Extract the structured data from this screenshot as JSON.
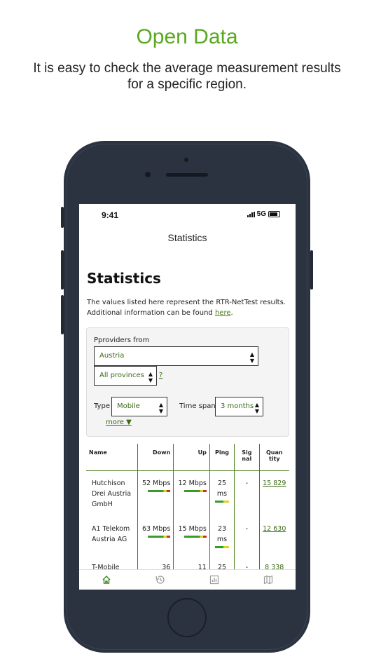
{
  "hero": {
    "title": "Open Data",
    "subtitle": "It is easy to check the average measurement results for a specific region."
  },
  "status_bar": {
    "time": "9:41",
    "network": "5G"
  },
  "nav": {
    "title": "Statistics"
  },
  "page": {
    "heading": "Statistics",
    "intro_text": "The values listed here represent the RTR-NetTest results. Additional information can be found",
    "intro_link": "here",
    "intro_end": "."
  },
  "filter": {
    "providers_label": "Pproviders from",
    "country_value": "Austria",
    "province_value": "All provinces",
    "help_link": "?",
    "type_label": "Type",
    "type_value": "Mobile",
    "timespan_label": "Time span",
    "timespan_value": "3 months",
    "more_link": "more ▼"
  },
  "table": {
    "headers": {
      "name": "Name",
      "down": "Down",
      "up": "Up",
      "ping": "Ping",
      "signal": "Sig nal",
      "quantity": "Quan tity"
    },
    "rows": [
      {
        "name": "Hutchison Drei Austria GmbH",
        "down": "52 Mbps",
        "up": "12 Mbps",
        "ping": "25 ms",
        "signal": "-",
        "quantity": "15 829"
      },
      {
        "name": "A1 Telekom Austria AG",
        "down": "63 Mbps",
        "up": "15 Mbps",
        "ping": "23 ms",
        "signal": "-",
        "quantity": "12 630"
      },
      {
        "name": "T-Mobile",
        "down": "36",
        "up": "11",
        "ping": "25",
        "signal": "-",
        "quantity": "8 338"
      }
    ]
  },
  "tabbar": {
    "items": [
      {
        "icon": "home-icon",
        "active": true
      },
      {
        "icon": "history-icon",
        "active": false
      },
      {
        "icon": "statistics-icon",
        "active": false
      },
      {
        "icon": "map-icon",
        "active": false
      }
    ]
  },
  "colors": {
    "accent": "#5aa820",
    "link": "#3b6a14",
    "phone_body": "#2b3340"
  }
}
